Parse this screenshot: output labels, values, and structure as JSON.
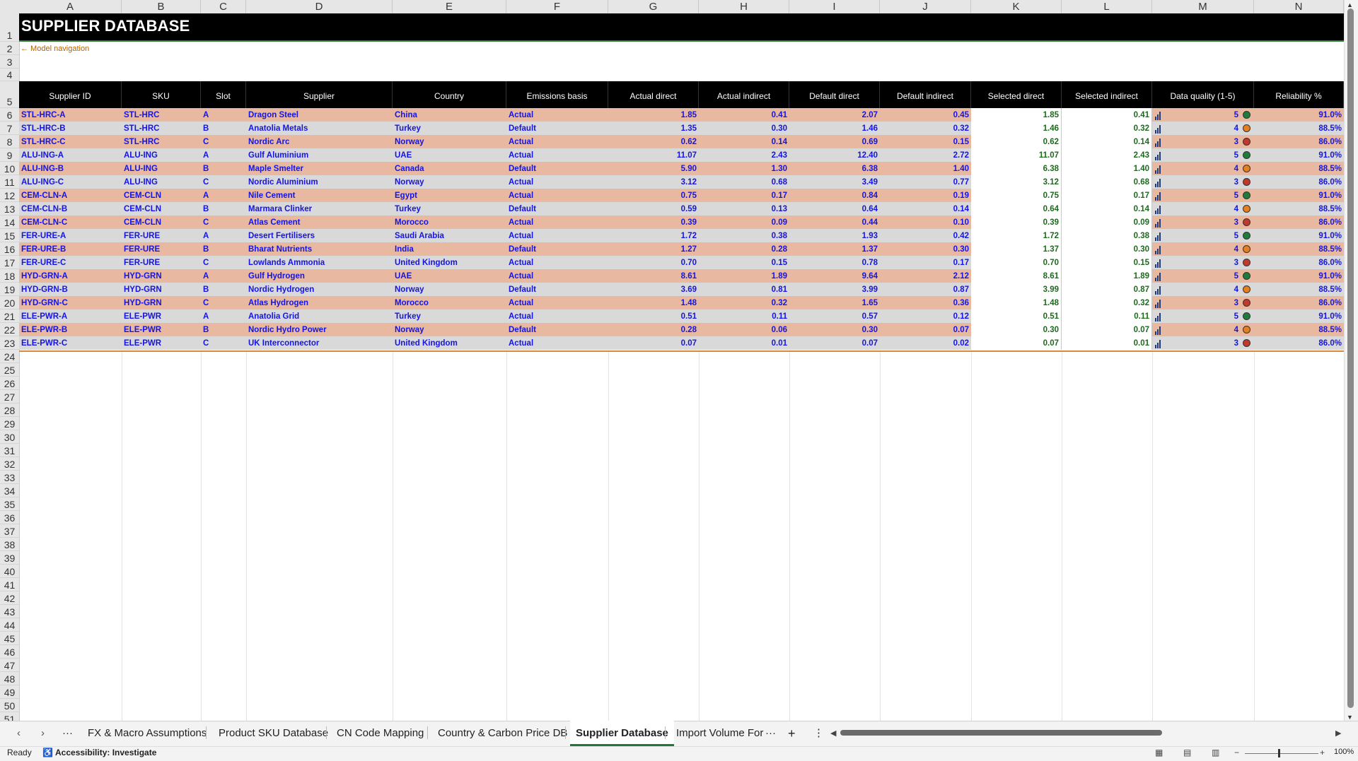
{
  "columns": [
    "A",
    "B",
    "C",
    "D",
    "E",
    "F",
    "G",
    "H",
    "I",
    "J",
    "K",
    "L",
    "M",
    "N"
  ],
  "rows": [
    "1",
    "2",
    "3",
    "4",
    "5",
    "6",
    "7",
    "8",
    "9",
    "10",
    "11",
    "12",
    "13",
    "14",
    "15",
    "16",
    "17",
    "18",
    "19",
    "20",
    "21",
    "22",
    "23",
    "24",
    "25",
    "26",
    "27",
    "28",
    "29",
    "30",
    "31",
    "32",
    "33",
    "34",
    "35",
    "36",
    "37",
    "38",
    "39",
    "40",
    "41",
    "42",
    "43",
    "44",
    "45",
    "46",
    "47",
    "48",
    "49",
    "50",
    "51"
  ],
  "sheet": {
    "title": "SUPPLIER DATABASE",
    "nav_link": "← Model navigation"
  },
  "table": {
    "headers": [
      "Supplier ID",
      "SKU",
      "Slot",
      "Supplier",
      "Country",
      "Emissions basis",
      "Actual direct",
      "Actual indirect",
      "Default direct",
      "Default indirect",
      "Selected direct",
      "Selected indirect",
      "Data quality (1-5)",
      "Reliability %"
    ],
    "rows": [
      {
        "id": "STL-HRC-A",
        "sku": "STL-HRC",
        "slot": "A",
        "supplier": "Dragon Steel",
        "country": "China",
        "basis": "Actual",
        "ad": "1.85",
        "ai": "0.41",
        "dd": "2.07",
        "di": "0.45",
        "sd": "1.85",
        "si": "0.41",
        "dq": "5",
        "rel": "91.0%",
        "dot": "#1e7b3c"
      },
      {
        "id": "STL-HRC-B",
        "sku": "STL-HRC",
        "slot": "B",
        "supplier": "Anatolia Metals",
        "country": "Turkey",
        "basis": "Default",
        "ad": "1.35",
        "ai": "0.30",
        "dd": "1.46",
        "di": "0.32",
        "sd": "1.46",
        "si": "0.32",
        "dq": "4",
        "rel": "88.5%",
        "dot": "#e67e22"
      },
      {
        "id": "STL-HRC-C",
        "sku": "STL-HRC",
        "slot": "C",
        "supplier": "Nordic Arc",
        "country": "Norway",
        "basis": "Actual",
        "ad": "0.62",
        "ai": "0.14",
        "dd": "0.69",
        "di": "0.15",
        "sd": "0.62",
        "si": "0.14",
        "dq": "3",
        "rel": "86.0%",
        "dot": "#c0392b"
      },
      {
        "id": "ALU-ING-A",
        "sku": "ALU-ING",
        "slot": "A",
        "supplier": "Gulf Aluminium",
        "country": "UAE",
        "basis": "Actual",
        "ad": "11.07",
        "ai": "2.43",
        "dd": "12.40",
        "di": "2.72",
        "sd": "11.07",
        "si": "2.43",
        "dq": "5",
        "rel": "91.0%",
        "dot": "#1e7b3c"
      },
      {
        "id": "ALU-ING-B",
        "sku": "ALU-ING",
        "slot": "B",
        "supplier": "Maple Smelter",
        "country": "Canada",
        "basis": "Default",
        "ad": "5.90",
        "ai": "1.30",
        "dd": "6.38",
        "di": "1.40",
        "sd": "6.38",
        "si": "1.40",
        "dq": "4",
        "rel": "88.5%",
        "dot": "#e67e22"
      },
      {
        "id": "ALU-ING-C",
        "sku": "ALU-ING",
        "slot": "C",
        "supplier": "Nordic Aluminium",
        "country": "Norway",
        "basis": "Actual",
        "ad": "3.12",
        "ai": "0.68",
        "dd": "3.49",
        "di": "0.77",
        "sd": "3.12",
        "si": "0.68",
        "dq": "3",
        "rel": "86.0%",
        "dot": "#c0392b"
      },
      {
        "id": "CEM-CLN-A",
        "sku": "CEM-CLN",
        "slot": "A",
        "supplier": "Nile Cement",
        "country": "Egypt",
        "basis": "Actual",
        "ad": "0.75",
        "ai": "0.17",
        "dd": "0.84",
        "di": "0.19",
        "sd": "0.75",
        "si": "0.17",
        "dq": "5",
        "rel": "91.0%",
        "dot": "#1e7b3c"
      },
      {
        "id": "CEM-CLN-B",
        "sku": "CEM-CLN",
        "slot": "B",
        "supplier": "Marmara Clinker",
        "country": "Turkey",
        "basis": "Default",
        "ad": "0.59",
        "ai": "0.13",
        "dd": "0.64",
        "di": "0.14",
        "sd": "0.64",
        "si": "0.14",
        "dq": "4",
        "rel": "88.5%",
        "dot": "#e67e22"
      },
      {
        "id": "CEM-CLN-C",
        "sku": "CEM-CLN",
        "slot": "C",
        "supplier": "Atlas Cement",
        "country": "Morocco",
        "basis": "Actual",
        "ad": "0.39",
        "ai": "0.09",
        "dd": "0.44",
        "di": "0.10",
        "sd": "0.39",
        "si": "0.09",
        "dq": "3",
        "rel": "86.0%",
        "dot": "#c0392b"
      },
      {
        "id": "FER-URE-A",
        "sku": "FER-URE",
        "slot": "A",
        "supplier": "Desert Fertilisers",
        "country": "Saudi Arabia",
        "basis": "Actual",
        "ad": "1.72",
        "ai": "0.38",
        "dd": "1.93",
        "di": "0.42",
        "sd": "1.72",
        "si": "0.38",
        "dq": "5",
        "rel": "91.0%",
        "dot": "#1e7b3c"
      },
      {
        "id": "FER-URE-B",
        "sku": "FER-URE",
        "slot": "B",
        "supplier": "Bharat Nutrients",
        "country": "India",
        "basis": "Default",
        "ad": "1.27",
        "ai": "0.28",
        "dd": "1.37",
        "di": "0.30",
        "sd": "1.37",
        "si": "0.30",
        "dq": "4",
        "rel": "88.5%",
        "dot": "#e67e22"
      },
      {
        "id": "FER-URE-C",
        "sku": "FER-URE",
        "slot": "C",
        "supplier": "Lowlands Ammonia",
        "country": "United Kingdom",
        "basis": "Actual",
        "ad": "0.70",
        "ai": "0.15",
        "dd": "0.78",
        "di": "0.17",
        "sd": "0.70",
        "si": "0.15",
        "dq": "3",
        "rel": "86.0%",
        "dot": "#c0392b"
      },
      {
        "id": "HYD-GRN-A",
        "sku": "HYD-GRN",
        "slot": "A",
        "supplier": "Gulf Hydrogen",
        "country": "UAE",
        "basis": "Actual",
        "ad": "8.61",
        "ai": "1.89",
        "dd": "9.64",
        "di": "2.12",
        "sd": "8.61",
        "si": "1.89",
        "dq": "5",
        "rel": "91.0%",
        "dot": "#1e7b3c"
      },
      {
        "id": "HYD-GRN-B",
        "sku": "HYD-GRN",
        "slot": "B",
        "supplier": "Nordic Hydrogen",
        "country": "Norway",
        "basis": "Default",
        "ad": "3.69",
        "ai": "0.81",
        "dd": "3.99",
        "di": "0.87",
        "sd": "3.99",
        "si": "0.87",
        "dq": "4",
        "rel": "88.5%",
        "dot": "#e67e22"
      },
      {
        "id": "HYD-GRN-C",
        "sku": "HYD-GRN",
        "slot": "C",
        "supplier": "Atlas Hydrogen",
        "country": "Morocco",
        "basis": "Actual",
        "ad": "1.48",
        "ai": "0.32",
        "dd": "1.65",
        "di": "0.36",
        "sd": "1.48",
        "si": "0.32",
        "dq": "3",
        "rel": "86.0%",
        "dot": "#c0392b"
      },
      {
        "id": "ELE-PWR-A",
        "sku": "ELE-PWR",
        "slot": "A",
        "supplier": "Anatolia Grid",
        "country": "Turkey",
        "basis": "Actual",
        "ad": "0.51",
        "ai": "0.11",
        "dd": "0.57",
        "di": "0.12",
        "sd": "0.51",
        "si": "0.11",
        "dq": "5",
        "rel": "91.0%",
        "dot": "#1e7b3c"
      },
      {
        "id": "ELE-PWR-B",
        "sku": "ELE-PWR",
        "slot": "B",
        "supplier": "Nordic Hydro Power",
        "country": "Norway",
        "basis": "Default",
        "ad": "0.28",
        "ai": "0.06",
        "dd": "0.30",
        "di": "0.07",
        "sd": "0.30",
        "si": "0.07",
        "dq": "4",
        "rel": "88.5%",
        "dot": "#e67e22"
      },
      {
        "id": "ELE-PWR-C",
        "sku": "ELE-PWR",
        "slot": "C",
        "supplier": "UK Interconnector",
        "country": "United Kingdom",
        "basis": "Actual",
        "ad": "0.07",
        "ai": "0.01",
        "dd": "0.07",
        "di": "0.02",
        "sd": "0.07",
        "si": "0.01",
        "dq": "3",
        "rel": "86.0%",
        "dot": "#c0392b"
      }
    ]
  },
  "tabs": {
    "items": [
      "FX & Macro Assumptions",
      "Product SKU Database",
      "CN Code Mapping",
      "Country & Carbon Price DB",
      "Supplier Database",
      "Import Volume For"
    ],
    "active": "Supplier Database",
    "more": "···",
    "add": "+",
    "options": "⋮"
  },
  "status": {
    "ready": "Ready",
    "accessibility": "Accessibility: Investigate",
    "zoom": "100%"
  },
  "colors": {
    "row_band_a": "#e8b9a0",
    "row_band_b": "#d9d9d9",
    "value_blue": "#1414e6",
    "selected_green": "#1b6b1b",
    "quality_high": "#1e7b3c",
    "quality_mid": "#e67e22",
    "quality_low": "#c0392b"
  }
}
